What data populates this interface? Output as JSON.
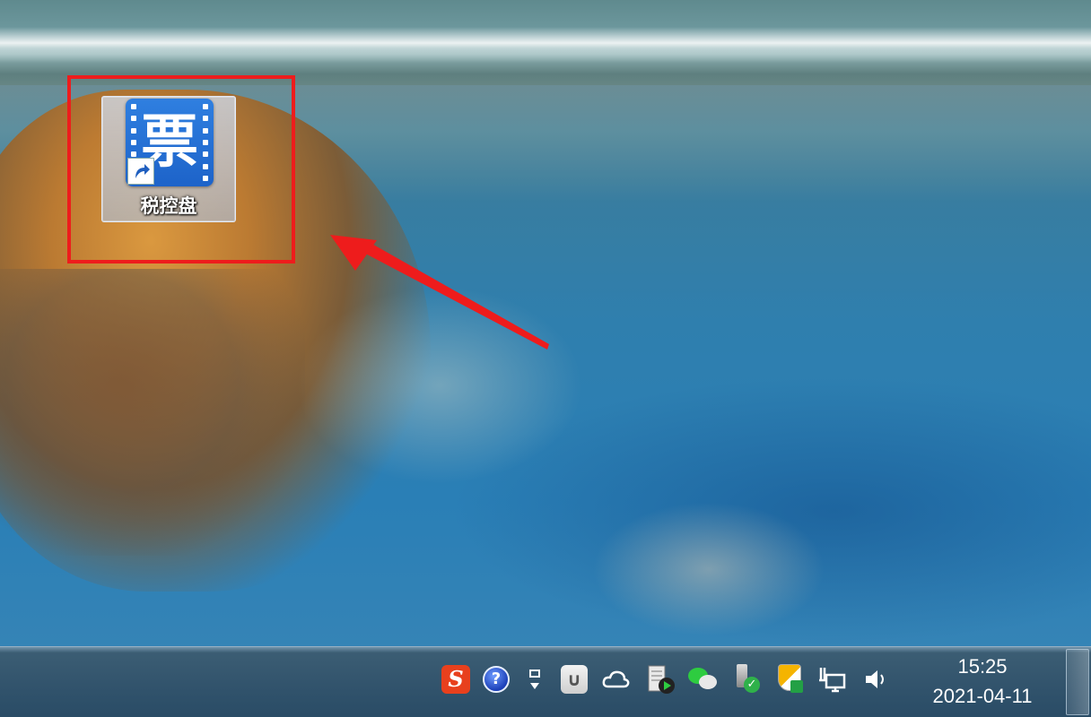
{
  "desktop": {
    "icons": [
      {
        "label": "税控盘",
        "glyph": "票",
        "icon": "piao-app-icon",
        "shortcut": true,
        "selected": true
      }
    ]
  },
  "annotation": {
    "box_color": "#ee1c1c",
    "arrow_color": "#ee1c1c"
  },
  "taskbar": {
    "tray_icons": [
      {
        "name": "sogou-input-icon",
        "glyph": "S"
      },
      {
        "name": "help-icon",
        "glyph": "?"
      },
      {
        "name": "show-hidden-icons-icon"
      },
      {
        "name": "paperclip-icon",
        "glyph": "∪"
      },
      {
        "name": "cloud-icon",
        "glyph": "☁"
      },
      {
        "name": "server-play-icon"
      },
      {
        "name": "wechat-icon"
      },
      {
        "name": "usb-safe-remove-icon",
        "glyph": "✓"
      },
      {
        "name": "security-shield-icon"
      },
      {
        "name": "network-icon"
      },
      {
        "name": "volume-icon",
        "glyph": "🔈"
      }
    ],
    "clock": {
      "time": "15:25",
      "date": "2021-04-11"
    }
  }
}
